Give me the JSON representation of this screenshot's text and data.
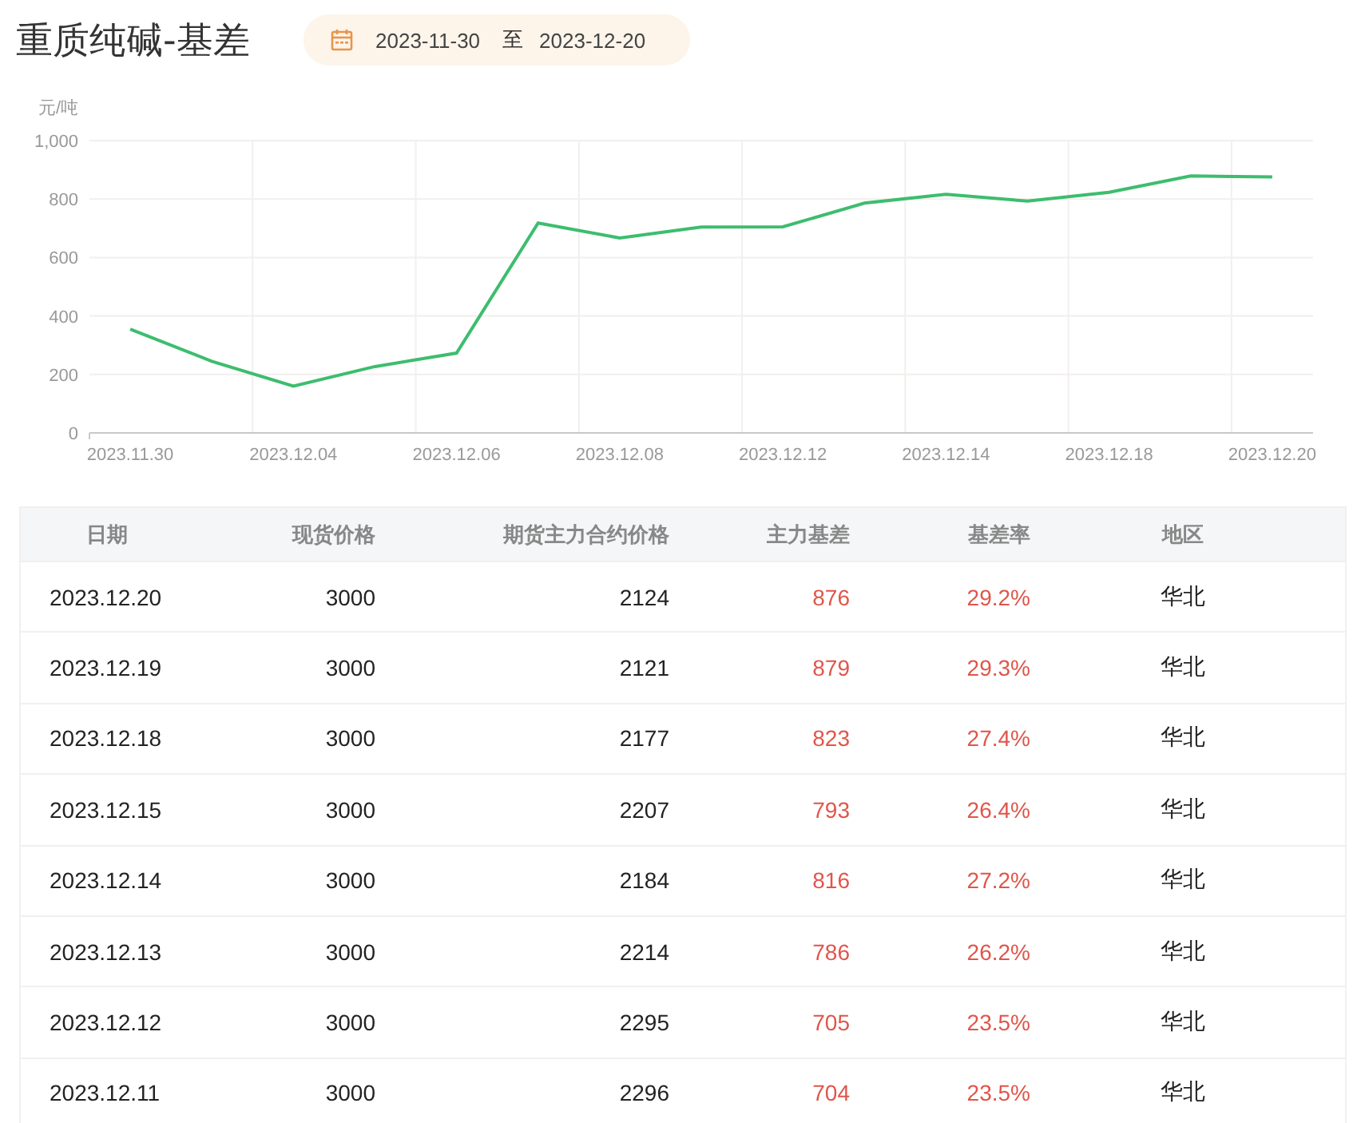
{
  "title": "重质纯碱-基差",
  "date_range": {
    "start": "2023-11-30",
    "separator": "至",
    "end": "2023-12-20"
  },
  "chart": {
    "chart_data": {
      "type": "line",
      "ylabel": "元/吨",
      "categories": [
        "2023.11.30",
        null,
        "2023.12.04",
        null,
        "2023.12.06",
        null,
        "2023.12.08",
        null,
        "2023.12.12",
        null,
        "2023.12.14",
        null,
        "2023.12.18",
        null,
        "2023.12.20"
      ],
      "series": [
        {
          "color": "#3dbd6e",
          "values": [
            355,
            245,
            160,
            227,
            273,
            718,
            667,
            704,
            705,
            786,
            816,
            793,
            823,
            879,
            876
          ]
        }
      ],
      "ylim": [
        0,
        1000
      ],
      "yticks": [
        0,
        200,
        400,
        600,
        800,
        {
          "value": 1000,
          "label": "1,000"
        }
      ],
      "grid": true
    }
  },
  "table": {
    "columns": [
      "日期",
      "现货价格",
      "期货主力合约价格",
      "主力基差",
      "基差率",
      "地区"
    ],
    "rows": [
      [
        "2023.12.20",
        "3000",
        "2124",
        "876",
        "29.2%",
        "华北"
      ],
      [
        "2023.12.19",
        "3000",
        "2121",
        "879",
        "29.3%",
        "华北"
      ],
      [
        "2023.12.18",
        "3000",
        "2177",
        "823",
        "27.4%",
        "华北"
      ],
      [
        "2023.12.15",
        "3000",
        "2207",
        "793",
        "26.4%",
        "华北"
      ],
      [
        "2023.12.14",
        "3000",
        "2184",
        "816",
        "27.2%",
        "华北"
      ],
      [
        "2023.12.13",
        "3000",
        "2214",
        "786",
        "26.2%",
        "华北"
      ],
      [
        "2023.12.12",
        "3000",
        "2295",
        "705",
        "23.5%",
        "华北"
      ],
      [
        "2023.12.11",
        "3000",
        "2296",
        "704",
        "23.5%",
        "华北"
      ]
    ]
  }
}
